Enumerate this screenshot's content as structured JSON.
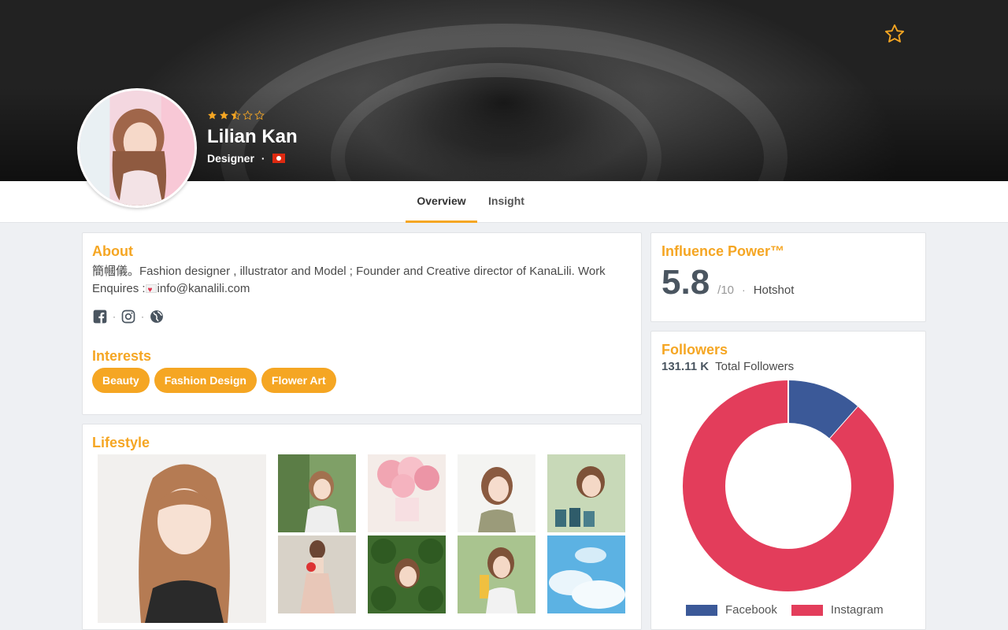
{
  "profile": {
    "name": "Lilian Kan",
    "role": "Designer",
    "rating": 2.5,
    "rating_max": 5,
    "country_flag": "hong-kong-flag"
  },
  "tabs": [
    {
      "label": "Overview",
      "active": true
    },
    {
      "label": "Insight",
      "active": false
    }
  ],
  "about": {
    "title": "About",
    "text_prefix": "簡幗儀。Fashion designer , illustrator and Model ; Founder and Creative director of KanaLili. Work Enquires :",
    "email": "info@kanalili.com",
    "socials": [
      "facebook-icon",
      "instagram-icon",
      "globe-icon"
    ]
  },
  "interests": {
    "title": "Interests",
    "items": [
      "Beauty",
      "Fashion Design",
      "Flower Art"
    ]
  },
  "lifestyle": {
    "title": "Lifestyle"
  },
  "influence": {
    "title": "Influence Power™",
    "score": "5.8",
    "max": "/10",
    "separator": "·",
    "level": "Hotshot"
  },
  "followers": {
    "title": "Followers",
    "total": "131.11 K",
    "total_label": "Total Followers"
  },
  "chart_data": {
    "type": "pie",
    "donut": true,
    "series": [
      {
        "name": "Facebook",
        "value": 11.5,
        "color": "#3b5998"
      },
      {
        "name": "Instagram",
        "value": 88.5,
        "color": "#e33d5b"
      }
    ],
    "legend": "bottom"
  },
  "colors": {
    "accent": "#f5a623",
    "facebook": "#3b5998",
    "instagram": "#e33d5b"
  }
}
